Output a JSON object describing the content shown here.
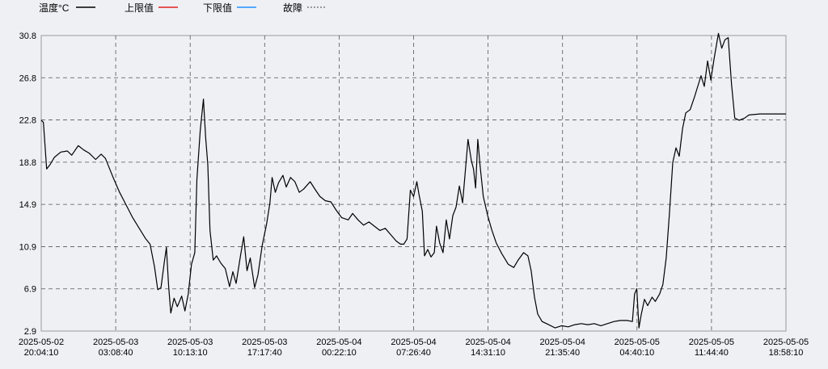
{
  "chart_data": {
    "type": "line",
    "legend": [
      {
        "label": "温度°C",
        "color": "#000000",
        "style": "solid"
      },
      {
        "label": "上限值",
        "color": "#e02020",
        "style": "solid"
      },
      {
        "label": "下限值",
        "color": "#1e90ff",
        "style": "solid"
      },
      {
        "label": "故障",
        "color": "#999999",
        "style": "dotted"
      }
    ],
    "legend_placement": "top-left",
    "grid": true,
    "ylim": [
      2.9,
      30.8
    ],
    "y_ticks": [
      "2.9",
      "6.9",
      "10.9",
      "14.9",
      "18.8",
      "22.8",
      "26.8",
      "30.8"
    ],
    "x_ticks": [
      {
        "date": "2025-05-02",
        "time": "20:04:10"
      },
      {
        "date": "2025-05-03",
        "time": "03:08:40"
      },
      {
        "date": "2025-05-03",
        "time": "10:13:10"
      },
      {
        "date": "2025-05-03",
        "time": "17:17:40"
      },
      {
        "date": "2025-05-04",
        "time": "00:22:10"
      },
      {
        "date": "2025-05-04",
        "time": "07:26:40"
      },
      {
        "date": "2025-05-04",
        "time": "14:31:10"
      },
      {
        "date": "2025-05-04",
        "time": "21:35:40"
      },
      {
        "date": "2025-05-05",
        "time": "04:40:10"
      },
      {
        "date": "2025-05-05",
        "time": "11:44:40"
      },
      {
        "date": "2025-05-05",
        "time": "18:58:10"
      }
    ],
    "series": [
      {
        "name": "温度°C",
        "color": "#000000",
        "points": [
          [
            0.0,
            22.8
          ],
          [
            0.1,
            22.6
          ],
          [
            0.25,
            18.2
          ],
          [
            0.4,
            18.6
          ],
          [
            0.6,
            19.3
          ],
          [
            0.9,
            19.8
          ],
          [
            1.2,
            19.9
          ],
          [
            1.4,
            19.5
          ],
          [
            1.7,
            20.4
          ],
          [
            1.95,
            20.0
          ],
          [
            2.2,
            19.7
          ],
          [
            2.5,
            19.1
          ],
          [
            2.75,
            19.6
          ],
          [
            2.95,
            19.2
          ],
          [
            3.3,
            17.4
          ],
          [
            3.6,
            16.0
          ],
          [
            3.9,
            14.8
          ],
          [
            4.2,
            13.6
          ],
          [
            4.5,
            12.6
          ],
          [
            4.8,
            11.6
          ],
          [
            5.0,
            11.1
          ],
          [
            5.2,
            9.0
          ],
          [
            5.35,
            6.8
          ],
          [
            5.5,
            7.0
          ],
          [
            5.65,
            9.4
          ],
          [
            5.75,
            10.8
          ],
          [
            5.85,
            7.2
          ],
          [
            5.95,
            4.6
          ],
          [
            6.1,
            6.0
          ],
          [
            6.25,
            5.2
          ],
          [
            6.45,
            6.2
          ],
          [
            6.6,
            4.8
          ],
          [
            6.75,
            6.4
          ],
          [
            6.9,
            9.2
          ],
          [
            7.05,
            10.3
          ],
          [
            7.15,
            17.2
          ],
          [
            7.3,
            21.8
          ],
          [
            7.45,
            24.8
          ],
          [
            7.55,
            21.2
          ],
          [
            7.65,
            18.6
          ],
          [
            7.75,
            12.4
          ],
          [
            7.9,
            9.6
          ],
          [
            8.05,
            10.0
          ],
          [
            8.25,
            9.3
          ],
          [
            8.45,
            8.8
          ],
          [
            8.65,
            7.1
          ],
          [
            8.8,
            8.5
          ],
          [
            8.95,
            7.4
          ],
          [
            9.15,
            10.0
          ],
          [
            9.3,
            11.8
          ],
          [
            9.45,
            8.6
          ],
          [
            9.6,
            9.8
          ],
          [
            9.8,
            7.0
          ],
          [
            9.95,
            8.2
          ],
          [
            10.15,
            11.0
          ],
          [
            10.35,
            13.0
          ],
          [
            10.5,
            15.0
          ],
          [
            10.6,
            17.4
          ],
          [
            10.75,
            16.0
          ],
          [
            10.9,
            16.9
          ],
          [
            11.1,
            17.6
          ],
          [
            11.25,
            16.5
          ],
          [
            11.45,
            17.4
          ],
          [
            11.65,
            17.0
          ],
          [
            11.85,
            16.0
          ],
          [
            12.05,
            16.3
          ],
          [
            12.35,
            17.0
          ],
          [
            12.6,
            16.2
          ],
          [
            12.8,
            15.6
          ],
          [
            13.05,
            15.2
          ],
          [
            13.3,
            15.1
          ],
          [
            13.55,
            14.3
          ],
          [
            13.8,
            13.6
          ],
          [
            14.1,
            13.4
          ],
          [
            14.3,
            14.0
          ],
          [
            14.55,
            13.4
          ],
          [
            14.8,
            12.9
          ],
          [
            15.05,
            13.2
          ],
          [
            15.3,
            12.8
          ],
          [
            15.55,
            12.4
          ],
          [
            15.8,
            12.6
          ],
          [
            16.05,
            12.0
          ],
          [
            16.3,
            11.4
          ],
          [
            16.5,
            11.1
          ],
          [
            16.65,
            11.1
          ],
          [
            16.8,
            11.6
          ],
          [
            16.95,
            16.2
          ],
          [
            17.1,
            15.6
          ],
          [
            17.25,
            17.0
          ],
          [
            17.35,
            15.8
          ],
          [
            17.5,
            14.2
          ],
          [
            17.6,
            10.0
          ],
          [
            17.75,
            10.6
          ],
          [
            17.9,
            9.9
          ],
          [
            18.05,
            10.3
          ],
          [
            18.15,
            12.8
          ],
          [
            18.3,
            11.2
          ],
          [
            18.45,
            10.3
          ],
          [
            18.6,
            13.4
          ],
          [
            18.75,
            11.6
          ],
          [
            18.9,
            13.8
          ],
          [
            19.05,
            14.6
          ],
          [
            19.2,
            16.6
          ],
          [
            19.35,
            15.0
          ],
          [
            19.45,
            17.4
          ],
          [
            19.6,
            21.0
          ],
          [
            19.75,
            19.0
          ],
          [
            19.85,
            18.2
          ],
          [
            19.95,
            16.4
          ],
          [
            20.05,
            21.0
          ],
          [
            20.15,
            18.6
          ],
          [
            20.3,
            15.6
          ],
          [
            20.5,
            13.8
          ],
          [
            20.7,
            12.4
          ],
          [
            20.9,
            11.2
          ],
          [
            21.15,
            10.2
          ],
          [
            21.45,
            9.2
          ],
          [
            21.7,
            8.9
          ],
          [
            21.9,
            9.6
          ],
          [
            22.15,
            10.3
          ],
          [
            22.35,
            10.0
          ],
          [
            22.5,
            8.6
          ],
          [
            22.65,
            6.1
          ],
          [
            22.8,
            4.5
          ],
          [
            23.0,
            3.8
          ],
          [
            23.3,
            3.5
          ],
          [
            23.6,
            3.2
          ],
          [
            23.9,
            3.4
          ],
          [
            24.2,
            3.3
          ],
          [
            24.5,
            3.5
          ],
          [
            24.8,
            3.6
          ],
          [
            25.1,
            3.5
          ],
          [
            25.4,
            3.6
          ],
          [
            25.7,
            3.4
          ],
          [
            26.0,
            3.6
          ],
          [
            26.3,
            3.8
          ],
          [
            26.6,
            3.9
          ],
          [
            26.9,
            3.9
          ],
          [
            27.15,
            3.8
          ],
          [
            27.25,
            6.4
          ],
          [
            27.35,
            6.9
          ],
          [
            27.45,
            3.2
          ],
          [
            27.55,
            4.4
          ],
          [
            27.7,
            5.9
          ],
          [
            27.85,
            5.3
          ],
          [
            28.05,
            6.1
          ],
          [
            28.2,
            5.7
          ],
          [
            28.4,
            6.4
          ],
          [
            28.55,
            7.3
          ],
          [
            28.7,
            9.8
          ],
          [
            28.85,
            14.0
          ],
          [
            29.0,
            18.8
          ],
          [
            29.15,
            20.2
          ],
          [
            29.3,
            19.4
          ],
          [
            29.45,
            22.0
          ],
          [
            29.6,
            23.5
          ],
          [
            29.8,
            23.8
          ],
          [
            30.0,
            25.0
          ],
          [
            30.15,
            26.0
          ],
          [
            30.3,
            27.0
          ],
          [
            30.45,
            26.0
          ],
          [
            30.6,
            28.4
          ],
          [
            30.75,
            26.6
          ],
          [
            30.9,
            28.6
          ],
          [
            31.0,
            29.8
          ],
          [
            31.1,
            31.0
          ],
          [
            31.25,
            29.6
          ],
          [
            31.4,
            30.4
          ],
          [
            31.55,
            30.6
          ],
          [
            31.7,
            26.2
          ],
          [
            31.85,
            23.0
          ],
          [
            32.05,
            22.8
          ],
          [
            32.3,
            23.0
          ],
          [
            32.5,
            23.3
          ],
          [
            33.0,
            23.4
          ],
          [
            33.5,
            23.4
          ],
          [
            34.2,
            23.4
          ]
        ]
      }
    ]
  }
}
